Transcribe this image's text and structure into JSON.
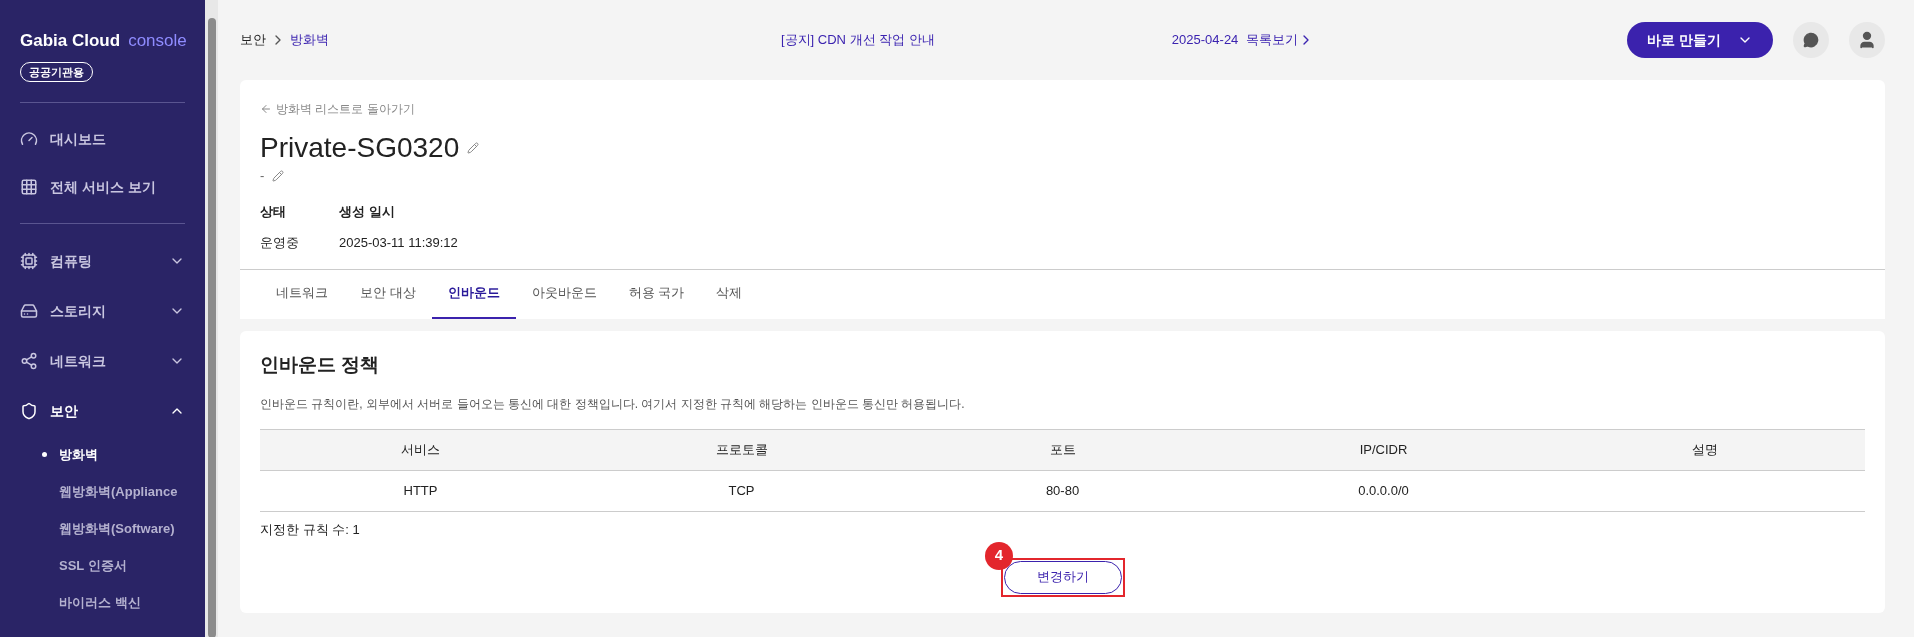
{
  "sidebar": {
    "logo": {
      "brand": "Gabia Cloud",
      "product": "console"
    },
    "badge": "공공기관용",
    "top_items": [
      {
        "label": "대시보드"
      },
      {
        "label": "전체 서비스 보기"
      }
    ],
    "groups": [
      {
        "label": "컴퓨팅",
        "expanded": false
      },
      {
        "label": "스토리지",
        "expanded": false
      },
      {
        "label": "네트워크",
        "expanded": false
      },
      {
        "label": "보안",
        "expanded": true,
        "children": [
          {
            "label": "방화벽",
            "selected": true
          },
          {
            "label": "웹방화벽(Appliance",
            "selected": false
          },
          {
            "label": "웹방화벽(Software)",
            "selected": false
          },
          {
            "label": "SSL 인증서",
            "selected": false
          },
          {
            "label": "바이러스 백신",
            "selected": false
          }
        ]
      }
    ]
  },
  "topbar": {
    "breadcrumb": [
      "보안",
      "방화벽"
    ],
    "notice": "[공지] CDN 개선 작업 안내",
    "notice_date": "2025-04-24",
    "list_link": "목록보기",
    "create_button": "바로 만들기"
  },
  "header": {
    "back_link": "방화벽 리스트로 돌아가기",
    "title": "Private-SG0320",
    "description": "-",
    "fields": [
      {
        "label": "상태",
        "value": "운영중"
      },
      {
        "label": "생성 일시",
        "value": "2025-03-11 11:39:12"
      }
    ],
    "tabs": [
      {
        "label": "네트워크",
        "selected": false
      },
      {
        "label": "보안 대상",
        "selected": false
      },
      {
        "label": "인바운드",
        "selected": true
      },
      {
        "label": "아웃바운드",
        "selected": false
      },
      {
        "label": "허용 국가",
        "selected": false
      },
      {
        "label": "삭제",
        "selected": false
      }
    ]
  },
  "policy": {
    "title": "인바운드 정책",
    "description": "인바운드 규칙이란, 외부에서 서버로 들어오는 통신에 대한 정책입니다. 여기서 지정한 규칙에 해당하는 인바운드 통신만 허용됩니다.",
    "table": {
      "columns": [
        "서비스",
        "프로토콜",
        "포트",
        "IP/CIDR",
        "설명"
      ],
      "rows": [
        [
          "HTTP",
          "TCP",
          "80-80",
          "0.0.0.0/0",
          ""
        ]
      ]
    },
    "rule_count": "지정한 규칙 수: 1",
    "change_button": "변경하기",
    "annotation": "4"
  }
}
